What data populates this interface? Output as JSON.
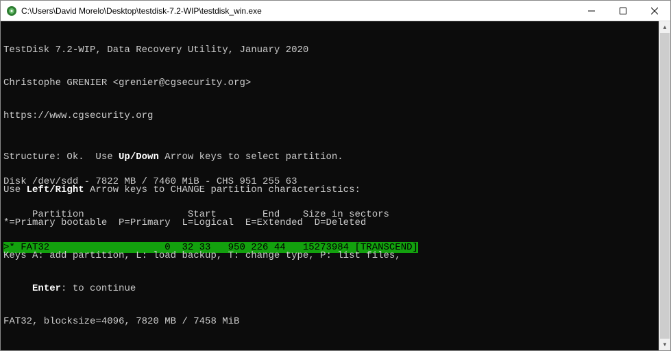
{
  "window": {
    "title": "C:\\Users\\David Morelo\\Desktop\\testdisk-7.2-WIP\\testdisk_win.exe"
  },
  "header": {
    "line1": "TestDisk 7.2-WIP, Data Recovery Utility, January 2020",
    "line2": "Christophe GRENIER <grenier@cgsecurity.org>",
    "line3": "https://www.cgsecurity.org"
  },
  "disk_info": "Disk /dev/sdd - 7822 MB / 7460 MiB - CHS 951 255 63",
  "table": {
    "header": "     Partition                  Start        End    Size in sectors",
    "row1": ">* FAT32                    0  32 33   950 226 44   15273984 [TRANSCEND]"
  },
  "footer": {
    "structure_pre": "Structure: Ok.  Use ",
    "structure_bold": "Up/Down",
    "structure_post": " Arrow keys to select partition.",
    "use_pre": "Use ",
    "use_bold": "Left/Right",
    "use_post": " Arrow keys to CHANGE partition characteristics:",
    "legend": "*=Primary bootable  P=Primary  L=Logical  E=Extended  D=Deleted",
    "keys": "Keys A: add partition, L: load backup, T: change type, P: list files,",
    "enter_pre": "     ",
    "enter_bold": "Enter",
    "enter_post": ": to continue",
    "fatinfo": "FAT32, blocksize=4096, 7820 MB / 7458 MiB"
  }
}
